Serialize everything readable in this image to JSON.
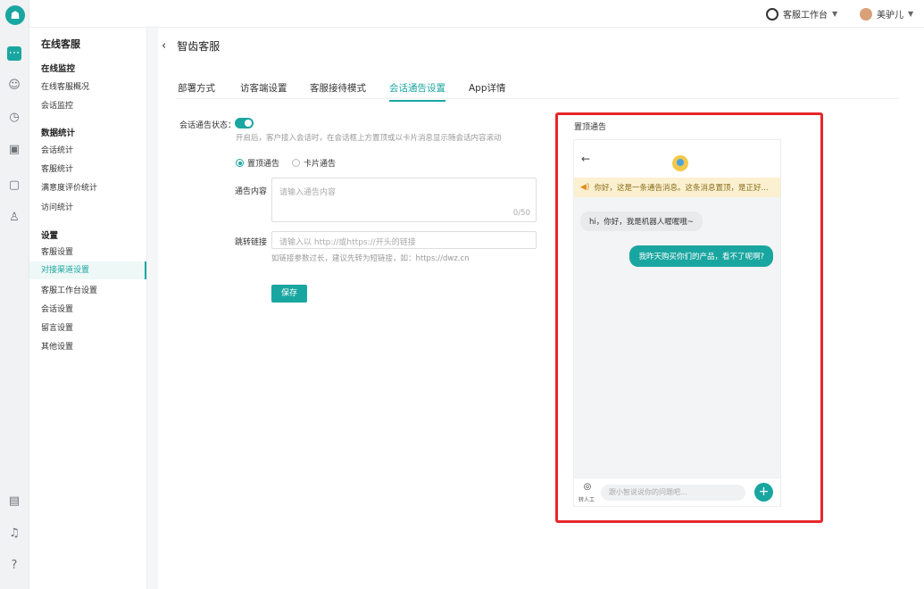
{
  "topbar": {
    "workspace_label": "客服工作台",
    "user_name": "美驴儿"
  },
  "sidebar": {
    "title": "在线客服",
    "groups": [
      {
        "label": "在线监控",
        "items": [
          "在线客服概况",
          "会话监控"
        ]
      },
      {
        "label": "数据统计",
        "items": [
          "会话统计",
          "客服统计",
          "满意度评价统计",
          "访问统计"
        ]
      },
      {
        "label": "设置",
        "items": [
          "客服设置",
          "对接渠道设置",
          "客服工作台设置",
          "会话设置",
          "留言设置",
          "其他设置"
        ]
      }
    ],
    "active_item": "对接渠道设置"
  },
  "page": {
    "title": "智齿客服",
    "tabs": [
      "部署方式",
      "访客端设置",
      "客服接待模式",
      "会话通告设置",
      "App详情"
    ],
    "active_tab": "会话通告设置"
  },
  "form": {
    "status_label": "会话通告状态：",
    "status_on": true,
    "status_hint": "开启后，客户接入会话时，在会话框上方置顶或以卡片消息显示随会话内容滚动",
    "radio_top": "置顶通告",
    "radio_card": "卡片通告",
    "content_label": "通告内容",
    "content_placeholder": "请输入通告内容",
    "content_count": "0/50",
    "link_label": "跳转链接",
    "link_placeholder": "请输入以 http://或https://开头的链接",
    "link_hint": "如链接参数过长，建议先转为短链接，如：https://dwz.cn",
    "save_label": "保存"
  },
  "preview": {
    "label": "置顶通告",
    "notice_text": "你好，这是一条通告消息。这条消息置顶，是正好...",
    "bot_message": "hi，你好，我是机器人喔喔哦~",
    "user_message": "我昨天购买你们的产品，看不了呢啊?",
    "input_placeholder": "跟小智说说你的问题吧...",
    "human_label": "转人工"
  },
  "colors": {
    "accent": "#1aa6a0",
    "highlight_box": "#e8262a",
    "notice_bg": "#fbf0cf"
  },
  "icons": {
    "rail": [
      "tooth-logo-icon",
      "chat-icon",
      "robot-icon",
      "clock-icon",
      "screen-icon",
      "monitor-icon",
      "person-icon",
      "note-icon",
      "bell-icon",
      "help-icon"
    ]
  }
}
